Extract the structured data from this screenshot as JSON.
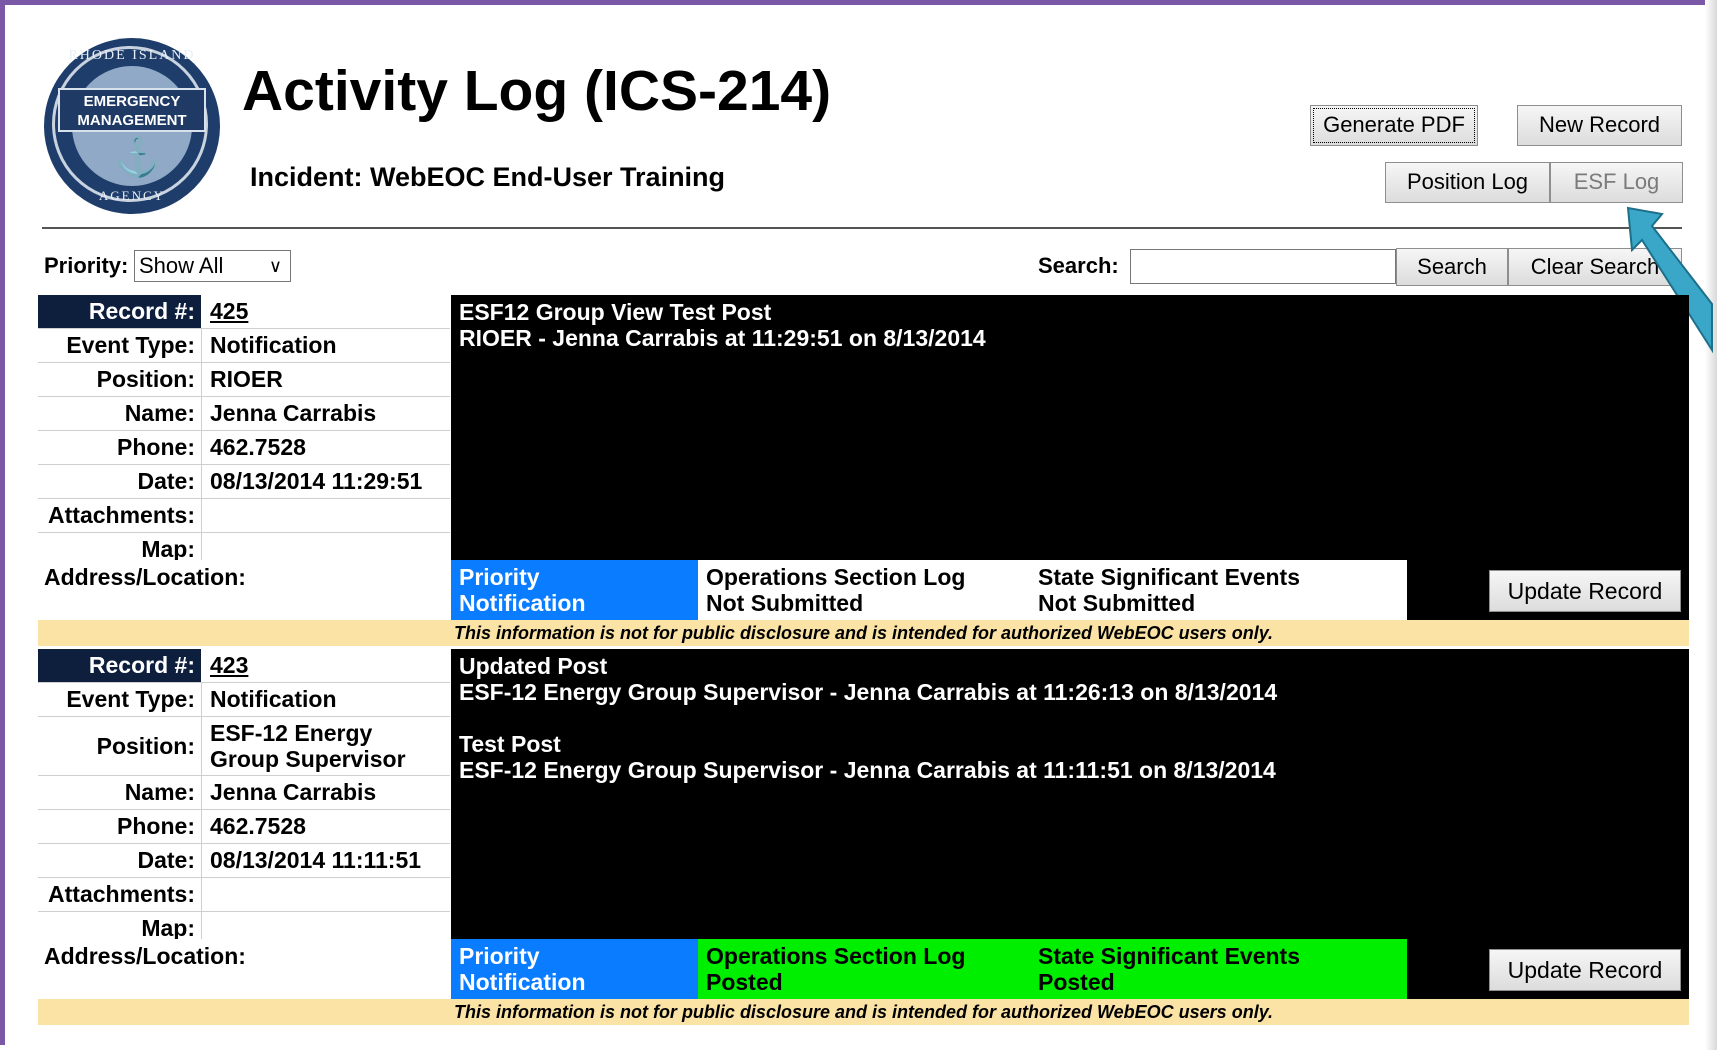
{
  "header": {
    "logo": {
      "top_text": "RHODE ISLAND",
      "line1": "EMERGENCY",
      "line2": "MANAGEMENT",
      "bottom_text": "AGENCY"
    },
    "title": "Activity Log (ICS-214)",
    "incident": "Incident: WebEOC End-User Training"
  },
  "toolbar": {
    "generate_pdf": "Generate PDF",
    "new_record": "New Record",
    "position_log": "Position Log",
    "esf_log": "ESF Log"
  },
  "filters": {
    "priority_label": "Priority:",
    "priority_value": "Show All",
    "search_label": "Search:",
    "search_value": "",
    "search_button": "Search",
    "clear_button": "Clear Search"
  },
  "labels": {
    "record": "Record #:",
    "event_type": "Event Type:",
    "position": "Position:",
    "name": "Name:",
    "phone": "Phone:",
    "date": "Date:",
    "attachments": "Attachments:",
    "map": "Map:",
    "address": "Address/Location:",
    "update": "Update Record",
    "notice": "This information is not for public disclosure and is intended for authorized WebEOC users only."
  },
  "records": [
    {
      "number": "425",
      "event_type": "Notification",
      "position": "RIOER",
      "name": "Jenna Carrabis",
      "phone": "462.7528",
      "date": "08/13/2014 11:29:51",
      "attachments": "",
      "map": "",
      "entries": [
        {
          "title": "ESF12 Group View Test Post",
          "byline": "RIOER - Jenna Carrabis at 11:29:51 on 8/13/2014"
        }
      ],
      "status": {
        "priority_title": "Priority",
        "priority_value": "Notification",
        "ops_title": "Operations Section Log",
        "ops_value": "Not Submitted",
        "sse_title": "State Significant Events",
        "sse_value": "Not Submitted"
      }
    },
    {
      "number": "423",
      "event_type": "Notification",
      "position_line1": "ESF-12 Energy",
      "position_line2": "Group Supervisor",
      "name": "Jenna Carrabis",
      "phone": "462.7528",
      "date": "08/13/2014 11:11:51",
      "attachments": "",
      "map": "",
      "entries": [
        {
          "title": "Updated Post",
          "byline": "ESF-12 Energy Group Supervisor - Jenna Carrabis at 11:26:13 on 8/13/2014"
        },
        {
          "title": "Test Post",
          "byline": "ESF-12 Energy Group Supervisor - Jenna Carrabis at 11:11:51 on 8/13/2014"
        }
      ],
      "status": {
        "priority_title": "Priority",
        "priority_value": "Notification",
        "ops_title": "Operations Section Log",
        "ops_value": "Posted",
        "sse_title": "State Significant Events",
        "sse_value": "Posted"
      }
    }
  ],
  "colors": {
    "priority_blue": "#0a7cff",
    "posted_green": "#00ee00",
    "header_navy": "#0d1f3c",
    "notice_bg": "#fbe3a6",
    "pointer": "#3aa7c9"
  }
}
